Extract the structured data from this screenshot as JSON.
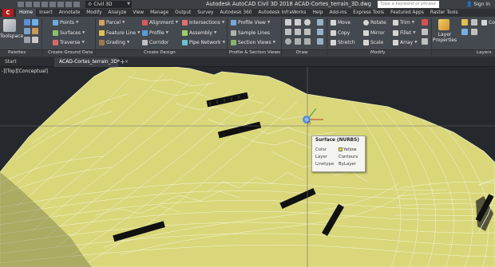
{
  "window": {
    "workspace": "Civil 3D",
    "title": "Autodesk AutoCAD Civil 3D 2018     ACAD-Cortes_terrain_3D.dwg",
    "search_placeholder": "Type a keyword or phrase",
    "sign_in": "Sign In"
  },
  "app_button": "C",
  "tabs": [
    "Home",
    "Insert",
    "Annotate",
    "Modify",
    "Analyze",
    "View",
    "Manage",
    "Output",
    "Survey",
    "Autodesk 360",
    "Autodesk InfraWorks",
    "Help",
    "Add-ins",
    "Express Tools",
    "Featured Apps",
    "Raster Tools"
  ],
  "active_tab": "Home",
  "ribbon": {
    "toolspace": "Toolspace",
    "ground": [
      "Points",
      "Surfaces",
      "Traverse"
    ],
    "design_col1": [
      "Parcel",
      "Feature Line",
      "Grading"
    ],
    "design_col2": [
      "Alignment",
      "Profile",
      "Corridor"
    ],
    "design_col3": [
      "Intersections",
      "Assembly",
      "Pipe Network"
    ],
    "profile_views": [
      "Profile View",
      "Sample Lines",
      "Section Views"
    ],
    "modify_col1": [
      "Move",
      "Copy",
      "Stretch"
    ],
    "modify_col2": [
      "Rotate",
      "Mirror",
      "Scale"
    ],
    "modify_col3": [
      "Trim",
      "Fillet",
      "Array"
    ],
    "layer_properties": "Layer Properties",
    "layer_properties_l1": "Layer",
    "layer_properties_l2": "Properties",
    "extra": "Co"
  },
  "panel_titles": {
    "palettes": "Palettes",
    "create_ground": "Create Ground Data",
    "create_design": "Create Design",
    "profile_section": "Profile & Section Views",
    "draw": "Draw",
    "modify": "Modify",
    "layers": "Layers"
  },
  "doc_tabs": {
    "start": "Start",
    "drawing": "ACAD-Cortes_terrain_3D*",
    "close": "×",
    "add": "+"
  },
  "viewport_label": "-][Top][Conceptual]",
  "tooltip": {
    "title": "Surface (NURBS)",
    "rows": [
      {
        "label": "Color",
        "value": "Yellow"
      },
      {
        "label": "Layer",
        "value": "Contours"
      },
      {
        "label": "Linetype",
        "value": "ByLayer"
      }
    ]
  },
  "colors": {
    "accent": "#b01c1c",
    "terrain": "#d9d77a",
    "ucs_x": "#c0392b",
    "ucs_y": "#2e8b57"
  }
}
